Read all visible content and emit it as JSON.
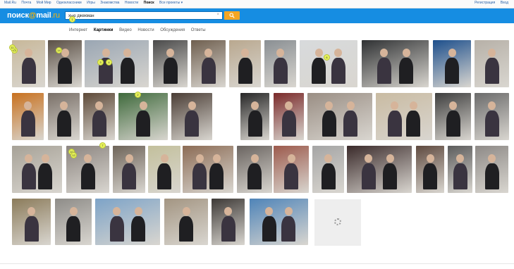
{
  "topbar": {
    "links": [
      "Mail.Ru",
      "Почта",
      "Мой Мир",
      "Одноклассники",
      "Игры",
      "Знакомства",
      "Новости",
      "Поиск",
      "Все проекты ▾"
    ],
    "right": [
      "Регистрация",
      "Вход"
    ]
  },
  "header": {
    "logo_text": "поиск",
    "logo_at": "@",
    "logo_mail": "mail",
    "logo_ru": ".ru",
    "search_value": "хью джекман",
    "clear_glyph": "×"
  },
  "tabs": [
    "Интернет",
    "Картинки",
    "Видео",
    "Новости",
    "Обсуждения",
    "Ответы"
  ],
  "active_tab_index": 1,
  "colors": {
    "header_blue": "#168de2",
    "search_button": "#f5a623",
    "marker": "#e7f25a"
  },
  "markers": [
    "1",
    "13",
    "14",
    "3",
    "6",
    "4",
    "2",
    "7",
    "10",
    "11",
    "12"
  ],
  "images_rows": 4
}
